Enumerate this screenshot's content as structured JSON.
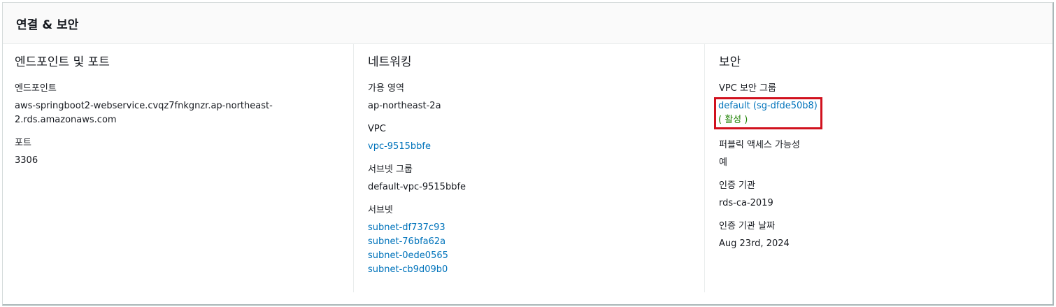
{
  "panel": {
    "title": "연결 & 보안"
  },
  "endpoint_column": {
    "title": "엔드포인트 및 포트",
    "endpoint_label": "엔드포인트",
    "endpoint_value_line1": "aws-springboot2-webservice.cvqz7fnkgnzr.ap-northeast-",
    "endpoint_value_line2": "2.rds.amazonaws.com",
    "port_label": "포트",
    "port_value": "3306"
  },
  "network_column": {
    "title": "네트워킹",
    "az_label": "가용 영역",
    "az_value": "ap-northeast-2a",
    "vpc_label": "VPC",
    "vpc_value": "vpc-9515bbfe",
    "subnet_group_label": "서브넷 그룹",
    "subnet_group_value": "default-vpc-9515bbfe",
    "subnets_label": "서브넷",
    "subnets": [
      "subnet-df737c93",
      "subnet-76bfa62a",
      "subnet-0ede0565",
      "subnet-cb9d09b0"
    ]
  },
  "security_column": {
    "title": "보안",
    "sg_label": "VPC 보안 그룹",
    "sg_value": "default (sg-dfde50b8)",
    "sg_status": "( 활성 )",
    "public_label": "퍼블릭 액세스 가능성",
    "public_value": "예",
    "ca_label": "인증 기관",
    "ca_value": "rds-ca-2019",
    "ca_date_label": "인증 기관 날짜",
    "ca_date_value": "Aug 23rd, 2024"
  },
  "colors": {
    "link": "#0073bb",
    "status_active": "#1d8102",
    "highlight_box": "#d1111e"
  }
}
